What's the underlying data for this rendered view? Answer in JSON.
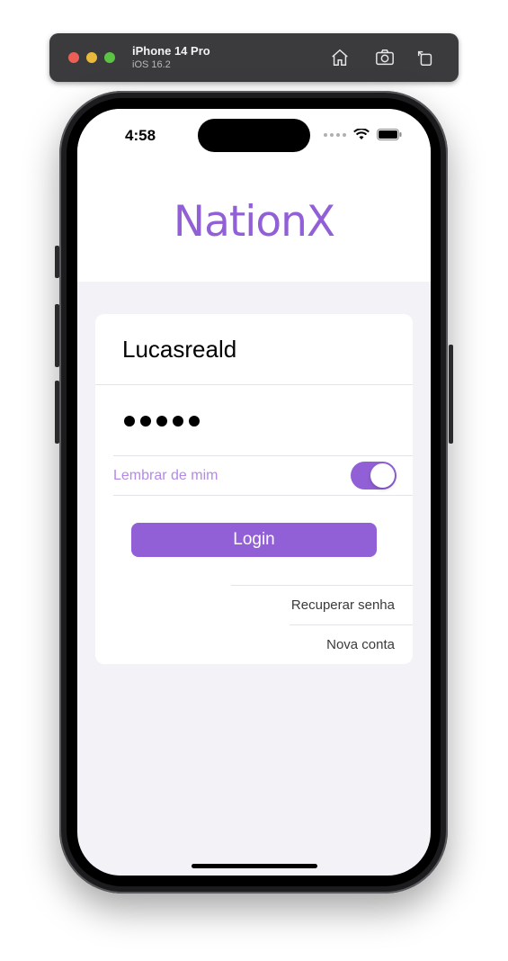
{
  "simulator": {
    "device_name": "iPhone 14 Pro",
    "os_version": "iOS 16.2",
    "icons": [
      "home-icon",
      "screenshot-icon",
      "rotate-icon"
    ]
  },
  "status_bar": {
    "time": "4:58"
  },
  "app": {
    "title": "NationX",
    "accent_color": "#9260d6"
  },
  "login_form": {
    "username_value": "Lucasreald",
    "password_masked": "•••••",
    "password_length": 5,
    "remember_label": "Lembrar de mim",
    "remember_on": true,
    "login_label": "Login",
    "recover_label": "Recuperar senha",
    "new_account_label": "Nova conta"
  }
}
